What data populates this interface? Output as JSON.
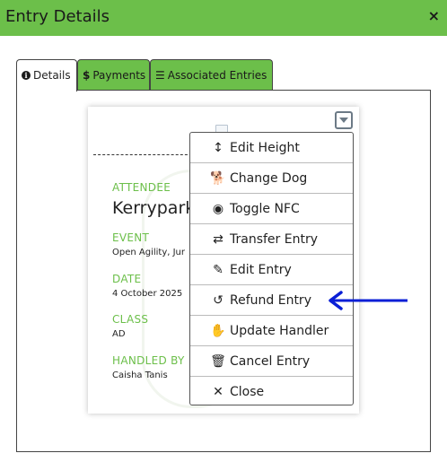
{
  "dialog": {
    "title": "Entry Details",
    "close_icon": "×"
  },
  "tabs": [
    {
      "label": "Details",
      "icon": "info-icon",
      "glyph": "i",
      "active": true
    },
    {
      "label": "Payments",
      "icon": "dollar-icon",
      "glyph": "$",
      "active": false
    },
    {
      "label": "Associated Entries",
      "icon": "list-icon",
      "glyph": "☰",
      "active": false
    }
  ],
  "entry": {
    "attendee_label": "ATTENDEE",
    "attendee_value": "Kerrypark",
    "event_label": "EVENT",
    "event_value": "Open Agility, Jur",
    "date_label": "DATE",
    "date_value": "4 October 2025",
    "class_label": "CLASS",
    "class_value": "AD",
    "handled_label": "HANDLED BY",
    "handled_value": "Caisha Tanis"
  },
  "menu": {
    "items": [
      {
        "label": "Edit Height",
        "icon": "vertical-arrows-icon",
        "glyph": "↕"
      },
      {
        "label": "Change Dog",
        "icon": "dog-icon",
        "glyph": "🐕"
      },
      {
        "label": "Toggle NFC",
        "icon": "radio-dot-icon",
        "glyph": "◉"
      },
      {
        "label": "Transfer Entry",
        "icon": "exchange-icon",
        "glyph": "⇄"
      },
      {
        "label": "Edit Entry",
        "icon": "edit-icon",
        "glyph": "✎"
      },
      {
        "label": "Refund Entry",
        "icon": "undo-icon",
        "glyph": "↺"
      },
      {
        "label": "Update Handler",
        "icon": "hand-icon",
        "glyph": "✋"
      },
      {
        "label": "Cancel Entry",
        "icon": "trash-icon",
        "glyph": "🗑"
      },
      {
        "label": "Close",
        "icon": "close-icon",
        "glyph": "✕"
      }
    ]
  },
  "colors": {
    "brand_green": "#6cbf4a",
    "annotation_arrow": "#0a1fd6"
  }
}
